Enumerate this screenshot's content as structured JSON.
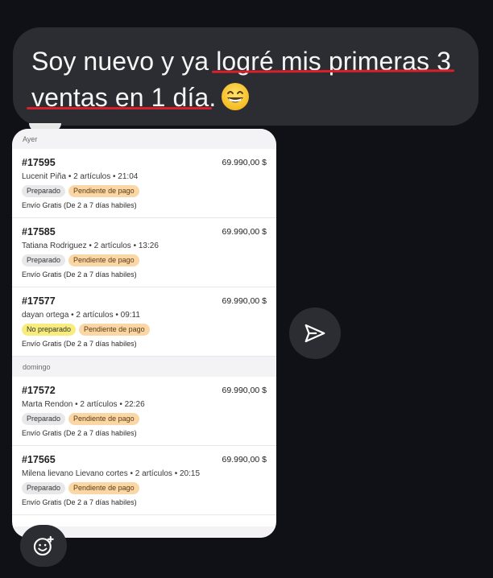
{
  "message": {
    "line1_plain": "Soy nuevo y ya ",
    "line1_highlight": "logré mis primeras 3",
    "line2_highlight": "ventas en 1 día.",
    "emoji": "grinning-face-with-smiling-eyes"
  },
  "colors": {
    "background": "#0f1116",
    "bubble": "#2b2d33",
    "underline": "#d91f2a",
    "tag_preparado": "#e8e8ea",
    "tag_no_preparado": "#f7ec7c",
    "tag_pendiente": "#fbd7a6"
  },
  "orders_screenshot": {
    "sections": [
      {
        "label": "Ayer",
        "orders": [
          {
            "id": "#17595",
            "price": "69.990,00 $",
            "meta": "Lucenit Piña • 2 artículos • 21:04",
            "status": "Preparado",
            "payment": "Pendiente de pago",
            "shipping": "Envío Gratis (De 2 a 7 días habiles)"
          },
          {
            "id": "#17585",
            "price": "69.990,00 $",
            "meta": "Tatiana Rodriguez • 2 artículos • 13:26",
            "status": "Preparado",
            "payment": "Pendiente de pago",
            "shipping": "Envío Gratis (De 2 a 7 días habiles)"
          },
          {
            "id": "#17577",
            "price": "69.990,00 $",
            "meta": "dayan ortega • 2 artículos • 09:11",
            "status": "No preparado",
            "payment": "Pendiente de pago",
            "shipping": "Envío Gratis (De 2 a 7 días habiles)"
          }
        ]
      },
      {
        "label": "domingo",
        "orders": [
          {
            "id": "#17572",
            "price": "69.990,00 $",
            "meta": "Marta Rendon • 2 artículos • 22:26",
            "status": "Preparado",
            "payment": "Pendiente de pago",
            "shipping": "Envío Gratis (De 2 a 7 días habiles)"
          },
          {
            "id": "#17565",
            "price": "69.990,00 $",
            "meta": "Milena lievano Lievano cortes • 2 artículos • 20:15",
            "status": "Preparado",
            "payment": "Pendiente de pago",
            "shipping": "Envío Gratis (De 2 a 7 días habiles)"
          }
        ]
      }
    ]
  },
  "actions": {
    "share_icon": "paper-plane-icon",
    "react_icon": "add-emoji-reaction-icon"
  }
}
